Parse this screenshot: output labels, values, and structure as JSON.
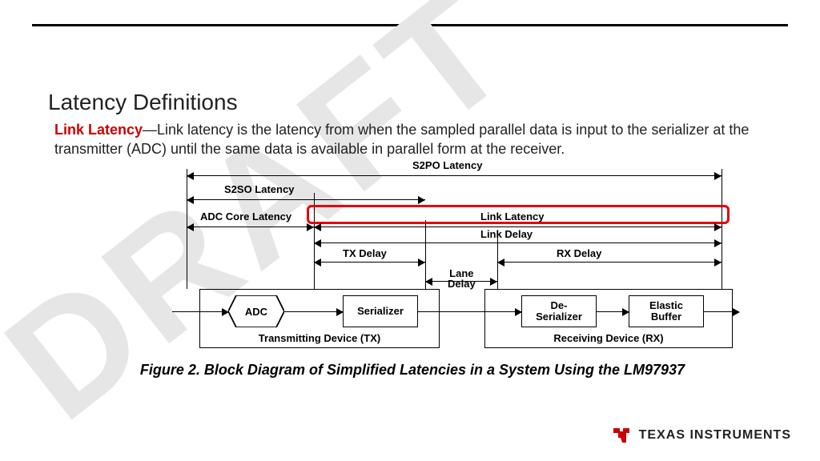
{
  "title": "Latency Definitions",
  "definition": {
    "term": "Link Latency",
    "dash": "—",
    "text": "Link latency is the latency from when the sampled parallel data is input to the serializer at the transmitter (ADC) until the same data is available in parallel form at the receiver."
  },
  "watermark": "DRAFT",
  "latencies": {
    "s2po": "S2PO Latency",
    "s2so": "S2SO Latency",
    "adc_core": "ADC Core Latency",
    "link_latency": "Link Latency",
    "link_delay": "Link Delay",
    "tx_delay": "TX Delay",
    "rx_delay": "RX Delay",
    "lane_delay": "Lane\nDelay"
  },
  "blocks": {
    "adc": "ADC",
    "serializer": "Serializer",
    "deserializer": "De-\nSerializer",
    "elastic": "Elastic\nBuffer",
    "tx": "Transmitting Device (TX)",
    "rx": "Receiving Device (RX)"
  },
  "caption": "Figure 2. Block Diagram of Simplified Latencies in a System Using the LM97937",
  "logo_text": "TEXAS INSTRUMENTS"
}
